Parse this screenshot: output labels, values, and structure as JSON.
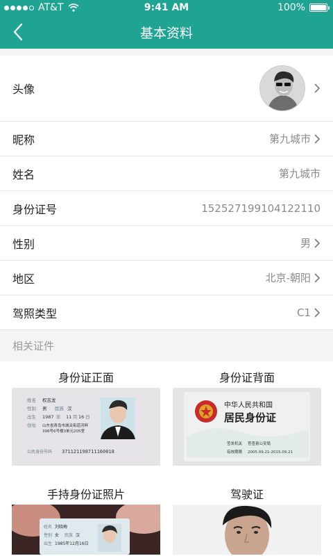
{
  "status_bar": {
    "carrier": "AT&T",
    "time": "9:41 AM",
    "battery": "100%"
  },
  "nav": {
    "title": "基本资料"
  },
  "profile": {
    "avatar_label": "头像",
    "rows": [
      {
        "label": "昵称",
        "value": "第九城市",
        "chevron": true
      },
      {
        "label": "姓名",
        "value": "第九城市",
        "chevron": false
      },
      {
        "label": "身份证号",
        "value": "152527199104122110",
        "chevron": false
      },
      {
        "label": "性别",
        "value": "男",
        "chevron": true
      },
      {
        "label": "地区",
        "value": "北京-朝阳",
        "chevron": true
      },
      {
        "label": "驾照类型",
        "value": "C1",
        "chevron": true
      }
    ]
  },
  "section": {
    "title": "相关证件"
  },
  "documents": [
    {
      "title": "身份证正面",
      "card": {
        "name_label": "姓名",
        "name": "权志龙",
        "sex_label": "性别",
        "sex": "男",
        "ethnic_label": "民族",
        "ethnic": "汉",
        "birth_label": "出生",
        "birth_year": "1987",
        "birth_month": "11",
        "birth_day": "16",
        "addr_label": "住址",
        "addr1": "山东省青岛市城关街道河畔",
        "addr2": "398号6号楼3单元205室",
        "id_label": "公民身份号码",
        "id_number": "371121198711160018"
      }
    },
    {
      "title": "身份证背面",
      "card": {
        "country": "中华人民共和国",
        "card_name": "居民身份证",
        "authority_label": "签发机关",
        "authority": "苍查县公安局",
        "valid_label": "有效期限",
        "valid": "2005.09.21-2015.09.21"
      }
    },
    {
      "title": "手持身份证照片",
      "card": {
        "name_label": "姓名",
        "name": "刘晓梅",
        "sex_label": "性别",
        "sex": "女",
        "ethnic_label": "民族",
        "ethnic": "汉",
        "birth_label": "出生",
        "birth": "1985年12月16日"
      }
    },
    {
      "title": "驾驶证"
    }
  ]
}
